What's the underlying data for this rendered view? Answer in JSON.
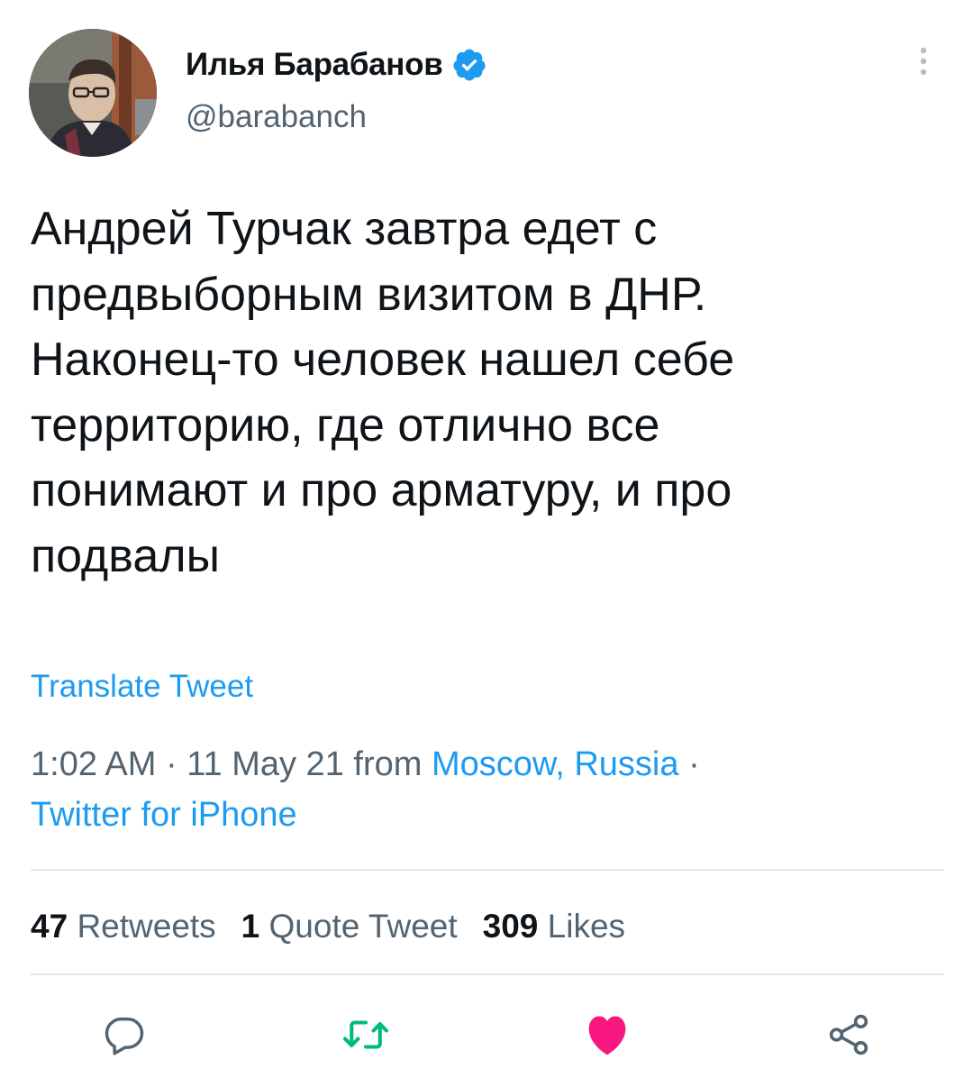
{
  "author": {
    "display_name": "Илья Барабанов",
    "handle": "@barabanch",
    "verified": true
  },
  "tweet": {
    "text": "Андрей Турчак завтра едет с\nпредвыборным визитом в ДНР.\nНаконец-то человек нашел себе\nтерриторию, где отлично все\nпонимают и про арматуру, и про\nподвалы",
    "translate_label": "Translate Tweet",
    "time": "1:02 AM",
    "date": "11 May 21",
    "from_label": "from",
    "location": "Moscow, Russia",
    "source": "Twitter for iPhone"
  },
  "stats": {
    "retweets_count": "47",
    "retweets_label": "Retweets",
    "quote_count": "1",
    "quote_label": "Quote Tweet",
    "likes_count": "309",
    "likes_label": "Likes"
  },
  "actions": {
    "reply_icon": "reply-icon",
    "retweet_icon": "retweet-icon",
    "like_icon": "heart-icon",
    "share_icon": "share-icon",
    "liked": true
  },
  "colors": {
    "accent": "#1d9bf0",
    "retweet_green": "#00ba7c",
    "like_pink": "#f91880",
    "secondary_text": "#536471"
  }
}
